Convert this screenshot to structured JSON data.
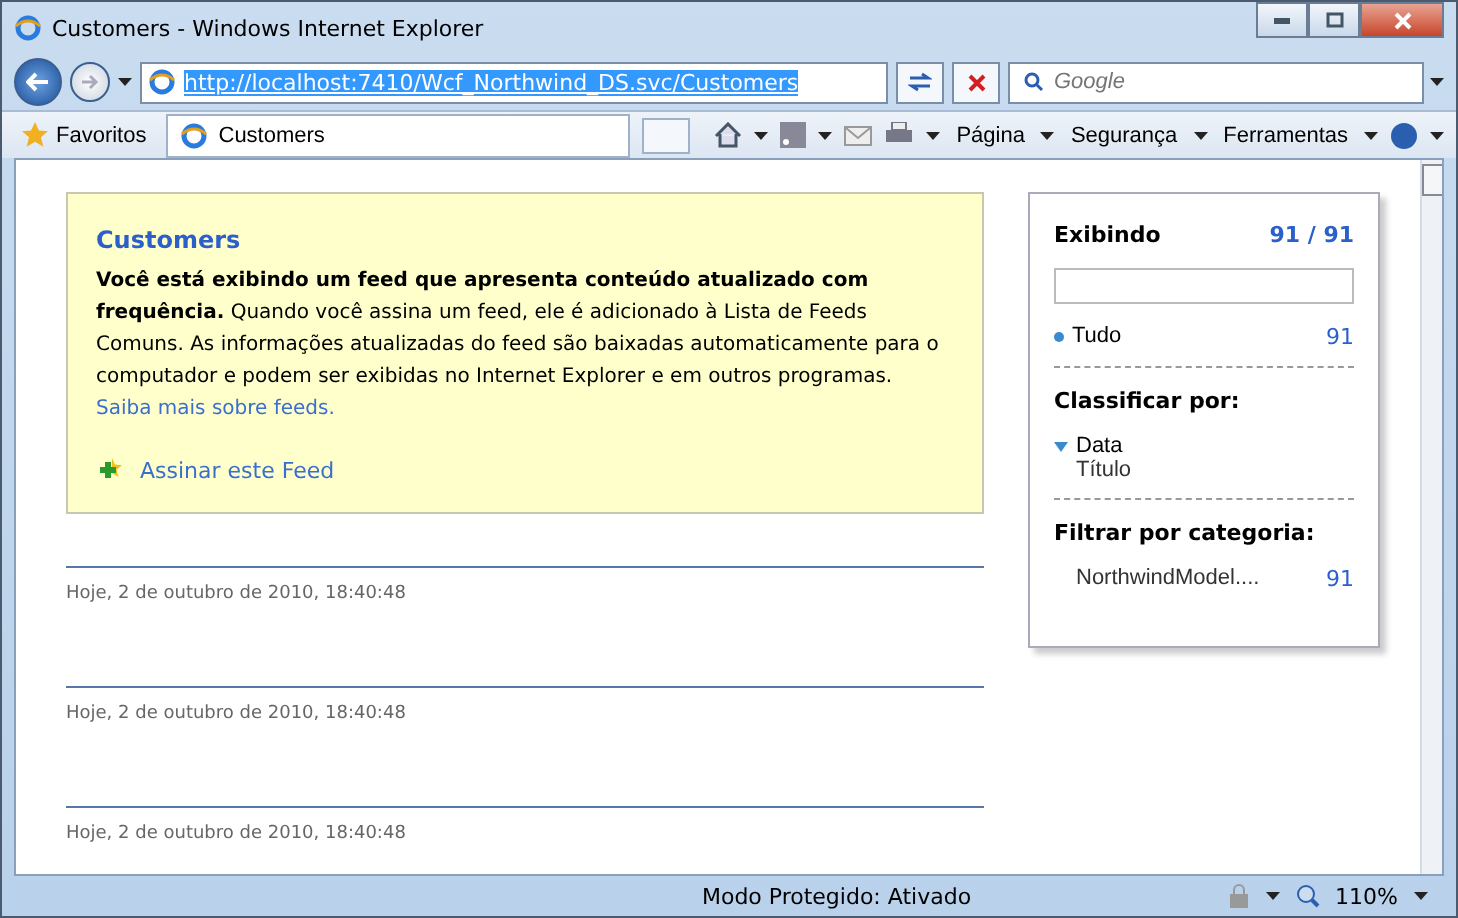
{
  "window": {
    "title": "Customers - Windows Internet Explorer"
  },
  "address_bar": {
    "url": "http://localhost:7410/Wcf_Northwind_DS.svc/Customers",
    "selected": true
  },
  "search": {
    "placeholder": "Google"
  },
  "toolbar": {
    "favorites": "Favoritos",
    "tab": "Customers",
    "menus": [
      "Página",
      "Segurança",
      "Ferramentas"
    ]
  },
  "feed": {
    "title": "Customers",
    "description": "**Você está exibindo um feed que apresenta conteúdo atualizado com frequência.** Quando você assina um feed, ele é adicionado à Lista de Feeds Comuns. As informações atualizadas do feed são baixadas automaticamente para o computador e podem ser exibidas no Internet Explorer e em outros programas.",
    "learn_more": "Saiba mais sobre feeds.",
    "subscribe": "Assinar este Feed"
  },
  "entries": [
    {
      "date": "Hoje, 2 de outubro de 2010, 18:40:48"
    },
    {
      "date": "Hoje, 2 de outubro de 2010, 18:40:48"
    },
    {
      "date": "Hoje, 2 de outubro de 2010, 18:40:48"
    }
  ],
  "sidebar": {
    "showing_label": "Exibindo",
    "showing_count": "91 / 91",
    "filters": [
      {
        "label": "Tudo",
        "count": "91",
        "selected": true
      }
    ],
    "sort_label": "Classificar por:",
    "sort_options": [
      {
        "label": "Data",
        "selected": true
      },
      {
        "label": "Título",
        "selected": false
      }
    ],
    "category_label": "Filtrar por categoria:",
    "categories": [
      {
        "label": "NorthwindModel....",
        "count": "91"
      }
    ]
  },
  "status_bar": {
    "text": "Modo Protegido: Ativado",
    "zoom": "110%"
  }
}
